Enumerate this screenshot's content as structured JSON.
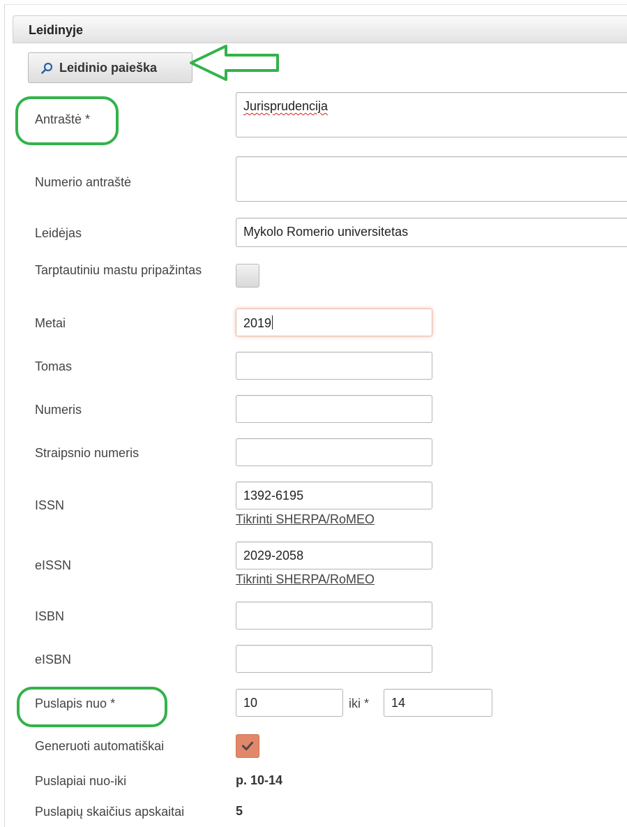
{
  "panel": {
    "title": "Leidinyje"
  },
  "search_button": {
    "label": "Leidinio paieška",
    "icon": "search-icon"
  },
  "fields": {
    "antraste": {
      "label": "Antraštė *",
      "value": "Jurisprudencija"
    },
    "numerio_antraste": {
      "label": "Numerio antraštė",
      "value": ""
    },
    "leidejas": {
      "label": "Leidėjas",
      "value": "Mykolo Romerio universitetas"
    },
    "tarptautiniu": {
      "label": "Tarptautiniu mastu pripažintas",
      "checked": false
    },
    "metai": {
      "label": "Metai",
      "value": "2019"
    },
    "tomas": {
      "label": "Tomas",
      "value": ""
    },
    "numeris": {
      "label": "Numeris",
      "value": ""
    },
    "straipsnio_numeris": {
      "label": "Straipsnio numeris",
      "value": ""
    },
    "issn": {
      "label": "ISSN",
      "value": "1392-6195",
      "link": "Tikrinti SHERPA/RoMEO"
    },
    "eissn": {
      "label": "eISSN",
      "value": "2029-2058",
      "link": "Tikrinti SHERPA/RoMEO"
    },
    "isbn": {
      "label": "ISBN",
      "value": ""
    },
    "eisbn": {
      "label": "eISBN",
      "value": ""
    },
    "puslapis_nuo": {
      "label": "Puslapis nuo *",
      "value": "10",
      "iki_label": "iki *",
      "iki_value": "14"
    },
    "generuoti": {
      "label": "Generuoti automatiškai",
      "checked": true
    },
    "puslapiai_nuo_iki": {
      "label": "Puslapiai nuo-iki",
      "value": "p. 10-14"
    },
    "puslapiu_skaicius": {
      "label": "Puslapių skaičius apskaitai",
      "value": "5"
    }
  },
  "annotation_color": "#33b34a",
  "accent_checkbox_color": "#e2876a"
}
